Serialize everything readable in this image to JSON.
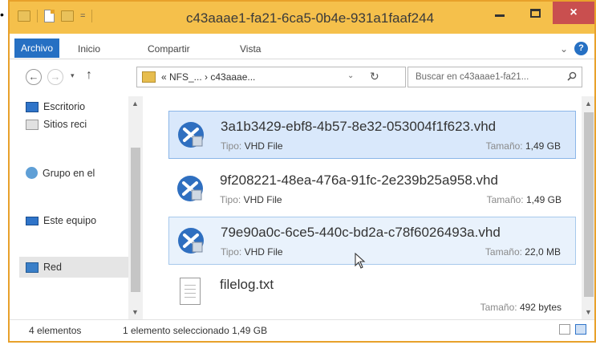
{
  "window": {
    "title": "c43aaae1-fa21-6ca5-0b4e-931a1faaf244",
    "close_glyph": "×"
  },
  "quick_access": {
    "dropdown_glyph": "="
  },
  "ribbon": {
    "tabs": [
      "Archivo",
      "Inicio",
      "Compartir",
      "Vista"
    ],
    "expand_glyph": "⌄",
    "help_glyph": "?"
  },
  "address": {
    "back_glyph": "←",
    "forward_glyph": "→",
    "recent_glyph": "▾",
    "up_glyph": "↑",
    "path": "« NFS_... › c43aaae...",
    "dropdown_glyph": "⌄",
    "refresh_glyph": "↻",
    "search_placeholder": "Buscar en c43aaae1-fa21..."
  },
  "nav_pane": {
    "items": [
      {
        "label": "Escritorio",
        "icon": "desktop-icon"
      },
      {
        "label": "Sitios reci",
        "icon": "recent-places-icon"
      },
      {
        "label": "Grupo en el",
        "icon": "homegroup-icon"
      },
      {
        "label": "Este equipo",
        "icon": "this-pc-icon"
      },
      {
        "label": "Red",
        "icon": "network-icon"
      }
    ],
    "selected": "Red"
  },
  "files": [
    {
      "name": "3a1b3429-ebf8-4b57-8e32-053004f1f623.vhd",
      "type_label": "Tipo:",
      "type": "VHD File",
      "size_label": "Tamaño:",
      "size": "1,49 GB",
      "icon": "vhd-file-icon",
      "state": "selected"
    },
    {
      "name": "9f208221-48ea-476a-91fc-2e239b25a958.vhd",
      "type_label": "Tipo:",
      "type": "VHD File",
      "size_label": "Tamaño:",
      "size": "1,49 GB",
      "icon": "vhd-file-icon",
      "state": "normal"
    },
    {
      "name": "79e90a0c-6ce5-440c-bd2a-c78f6026493a.vhd",
      "type_label": "Tipo:",
      "type": "VHD File",
      "size_label": "Tamaño:",
      "size": "22,0 MB",
      "icon": "vhd-file-icon",
      "state": "hover"
    },
    {
      "name": "filelog.txt",
      "type_label": "",
      "type": "",
      "size_label": "Tamaño:",
      "size": "492 bytes",
      "icon": "text-file-icon",
      "state": "normal"
    }
  ],
  "status_bar": {
    "count": "4 elementos",
    "selection": "1 elemento seleccionado  1,49 GB"
  },
  "colors": {
    "titlebar": "#f5c04b",
    "accent": "#2670c3",
    "selection": "#d9e8fb",
    "close": "#c94f4f"
  }
}
